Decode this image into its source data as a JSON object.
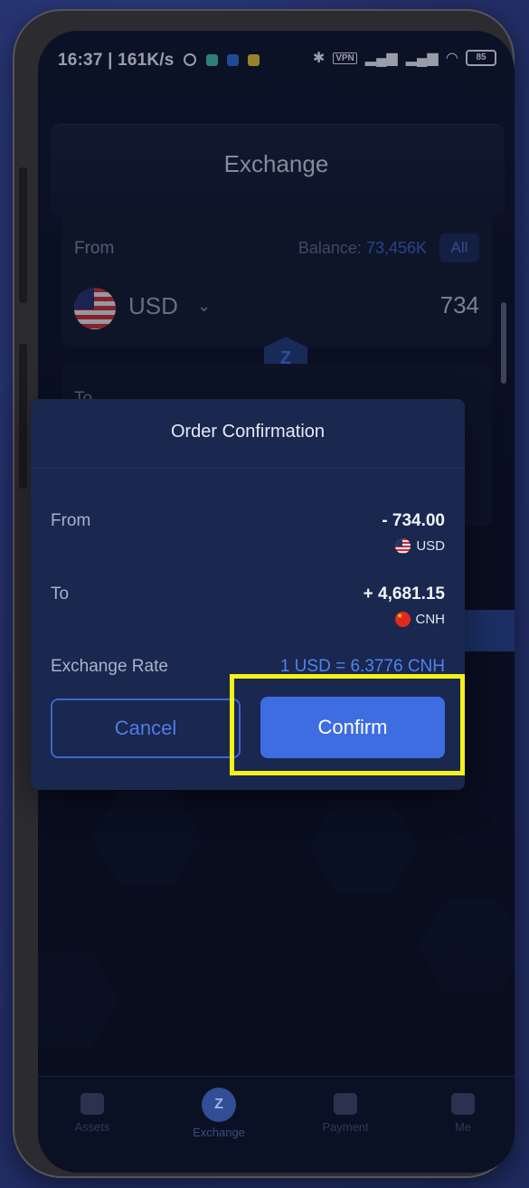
{
  "status_bar": {
    "time_speed": "16:37 | 161K/s",
    "battery": "85"
  },
  "header": {
    "title": "Exchange"
  },
  "from_section": {
    "label": "From",
    "balance_label": "Balance:",
    "balance_value": "73,456K",
    "all_button": "All",
    "currency": "USD",
    "amount": "734"
  },
  "to_section": {
    "label": "To"
  },
  "modal": {
    "title": "Order Confirmation",
    "from_label": "From",
    "from_amount": "- 734.00",
    "from_currency": "USD",
    "to_label": "To",
    "to_amount": "+ 4,681.15",
    "to_currency": "CNH",
    "rate_label": "Exchange Rate",
    "rate_value": "1 USD = 6.3776 CNH",
    "cancel_label": "Cancel",
    "confirm_label": "Confirm"
  },
  "bottom_nav": {
    "items": [
      {
        "label": "Assets"
      },
      {
        "label": "Exchange"
      },
      {
        "label": "Payment"
      },
      {
        "label": "Me"
      }
    ]
  },
  "colors": {
    "accent": "#3d6de0",
    "highlight": "#f4f21a",
    "modal_bg": "#1a274e"
  }
}
